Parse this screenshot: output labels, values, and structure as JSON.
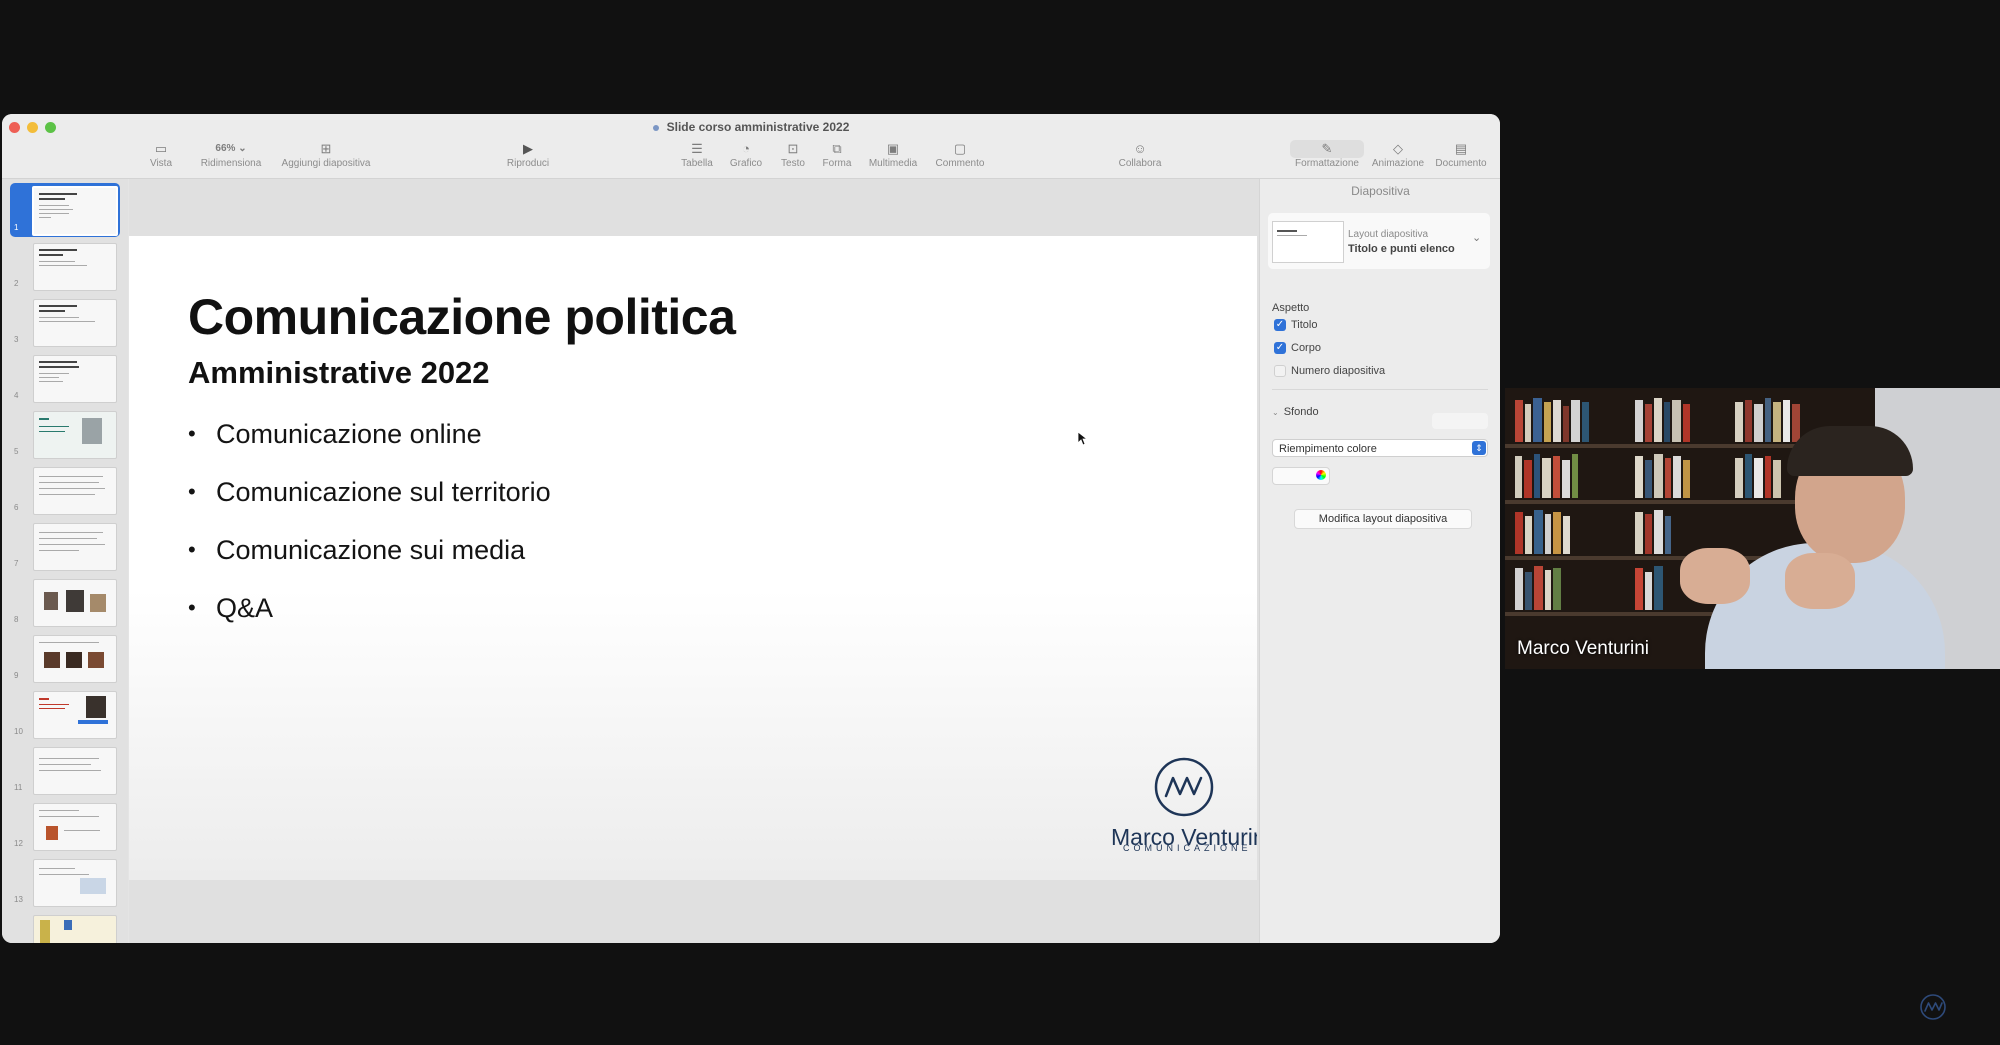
{
  "window": {
    "doc_title": "Slide corso amministrative 2022"
  },
  "toolbar": {
    "view": "Vista",
    "zoom_value": "66%",
    "zoom": "Ridimensiona",
    "add_slide": "Aggiungi diapositiva",
    "play": "Riproduci",
    "table": "Tabella",
    "chart": "Grafico",
    "text": "Testo",
    "shape": "Forma",
    "media": "Multimedia",
    "comment": "Commento",
    "collaborate": "Collabora",
    "format": "Formattazione",
    "animate": "Animazione",
    "document": "Documento"
  },
  "slide_numbers": [
    "1",
    "2",
    "3",
    "4",
    "5",
    "6",
    "7",
    "8",
    "9",
    "10",
    "11",
    "12",
    "13"
  ],
  "slide": {
    "title": "Comunicazione politica",
    "subtitle": "Amministrative 2022",
    "bullet_marker": "•",
    "bullets": [
      "Comunicazione online",
      "Comunicazione sul territorio",
      "Comunicazione sui media",
      "Q&A"
    ],
    "logo_name": "Marco Venturini",
    "logo_sub": "COMUNICAZIONE",
    "logo_color": "#1e3557"
  },
  "inspector": {
    "header": "Diapositiva",
    "layout_label": "Layout diapositiva",
    "layout_value": "Titolo e punti elenco",
    "appearance": "Aspetto",
    "title_check": "Titolo",
    "body_check": "Corpo",
    "slide_number_check": "Numero diapositiva",
    "background": "Sfondo",
    "fill_option": "Riempimento colore",
    "edit_layout": "Modifica layout diapositiva"
  },
  "video": {
    "participant_name": "Marco Venturini"
  },
  "colors": {
    "accent": "#2f72d8",
    "background": "#111111"
  },
  "icons": {
    "play": "play-icon",
    "checkbox": "checkmark-icon",
    "dropdown": "chevron-down-icon"
  }
}
